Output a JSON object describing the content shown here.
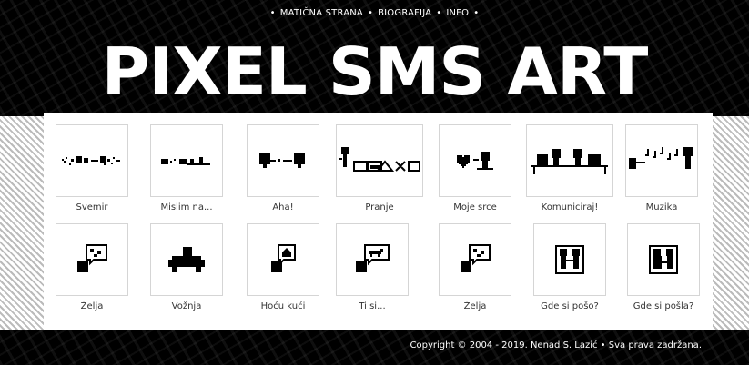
{
  "nav": {
    "items": [
      "MATIČNA STRANA",
      "BIOGRAFIJA",
      "INFO"
    ],
    "bullet": "•"
  },
  "site_title": "PIXEL SMS ART",
  "gallery": [
    {
      "caption": "Svemir",
      "icon": "space-pixel-art"
    },
    {
      "caption": "Mislim na...",
      "icon": "thinking-pixel-art"
    },
    {
      "caption": "Aha!",
      "icon": "aha-pixel-art"
    },
    {
      "caption": "Pranje",
      "icon": "washing-pixel-art"
    },
    {
      "caption": "Moje srce",
      "icon": "heart-pixel-art"
    },
    {
      "caption": "Komuniciraj!",
      "icon": "communicate-pixel-art"
    },
    {
      "caption": "Muzika",
      "icon": "music-pixel-art"
    },
    {
      "caption": "Želja",
      "icon": "wish-pixel-art"
    },
    {
      "caption": "Vožnja",
      "icon": "driving-pixel-art"
    },
    {
      "caption": "Hoću kući",
      "icon": "home-pixel-art"
    },
    {
      "caption": "Ti si...",
      "icon": "horse-pixel-art"
    },
    {
      "caption": "Želja",
      "icon": "wish-pixel-art"
    },
    {
      "caption": "Gde si pošo?",
      "icon": "couple-pixel-art"
    },
    {
      "caption": "Gde si pošla?",
      "icon": "couple-pixel-art"
    }
  ],
  "footer": {
    "copyright": "Copyright © 2004 - 2019. Nenad S. Lazić  •  Sva prava zadržana."
  }
}
